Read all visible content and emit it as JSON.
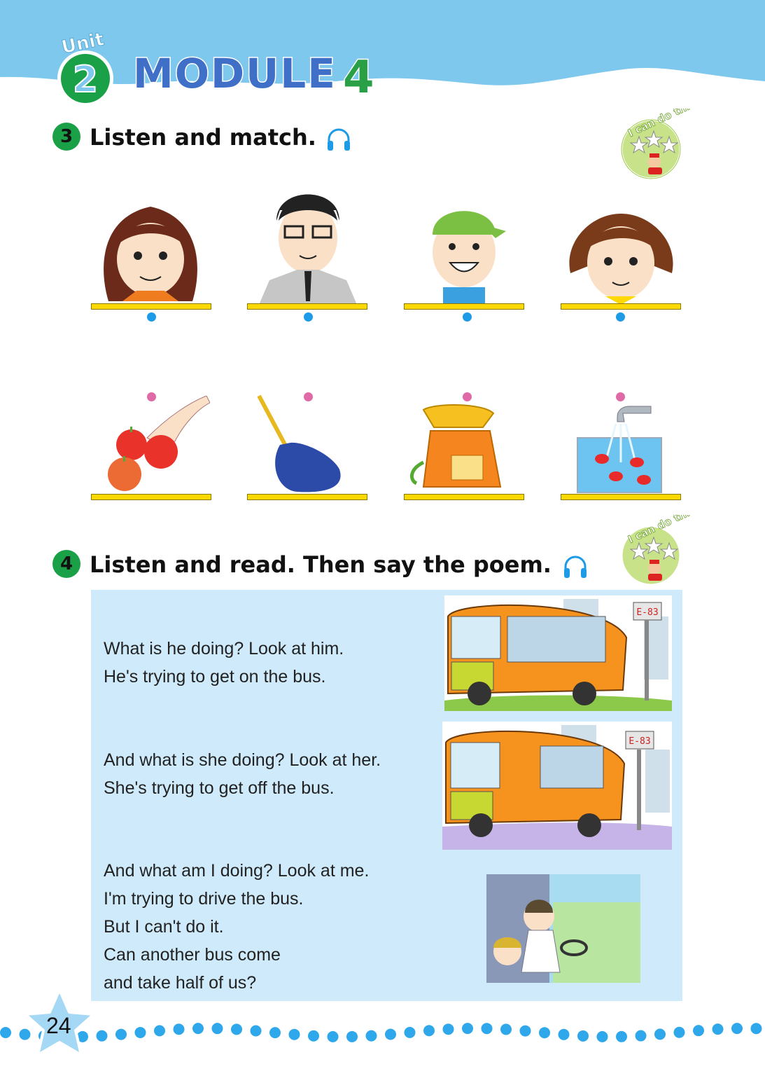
{
  "header": {
    "unit_word": "Unit",
    "unit_number": "2",
    "module_word": "MODULE",
    "module_number": "4"
  },
  "section3": {
    "number": "3",
    "title": "Listen and match.",
    "headphone_icon": "headphones-icon",
    "badge_text": "I can do this."
  },
  "section4": {
    "number": "4",
    "title": "Listen and read. Then say the poem.",
    "headphone_icon": "headphones-icon",
    "badge_text": "I can do this."
  },
  "poem": {
    "stanza1": [
      "What is he doing? Look at him.",
      "He's trying to get on the bus."
    ],
    "stanza2": [
      "And what is she doing? Look at her.",
      "She's trying to get off the bus."
    ],
    "stanza3": [
      "And what am I doing? Look at me.",
      "I'm trying to drive the bus.",
      "But I can't do it.",
      "Can another bus come",
      "and take half of us?"
    ]
  },
  "bus_sign": "E-83",
  "page_number": "24",
  "colors": {
    "sky": "#7ec8ee",
    "accent_green": "#1aa046",
    "line_yellow": "#ffd800",
    "poem_bg": "#cfeafa",
    "dot_blue": "#1e9be6",
    "dot_pink": "#e06aa8"
  }
}
